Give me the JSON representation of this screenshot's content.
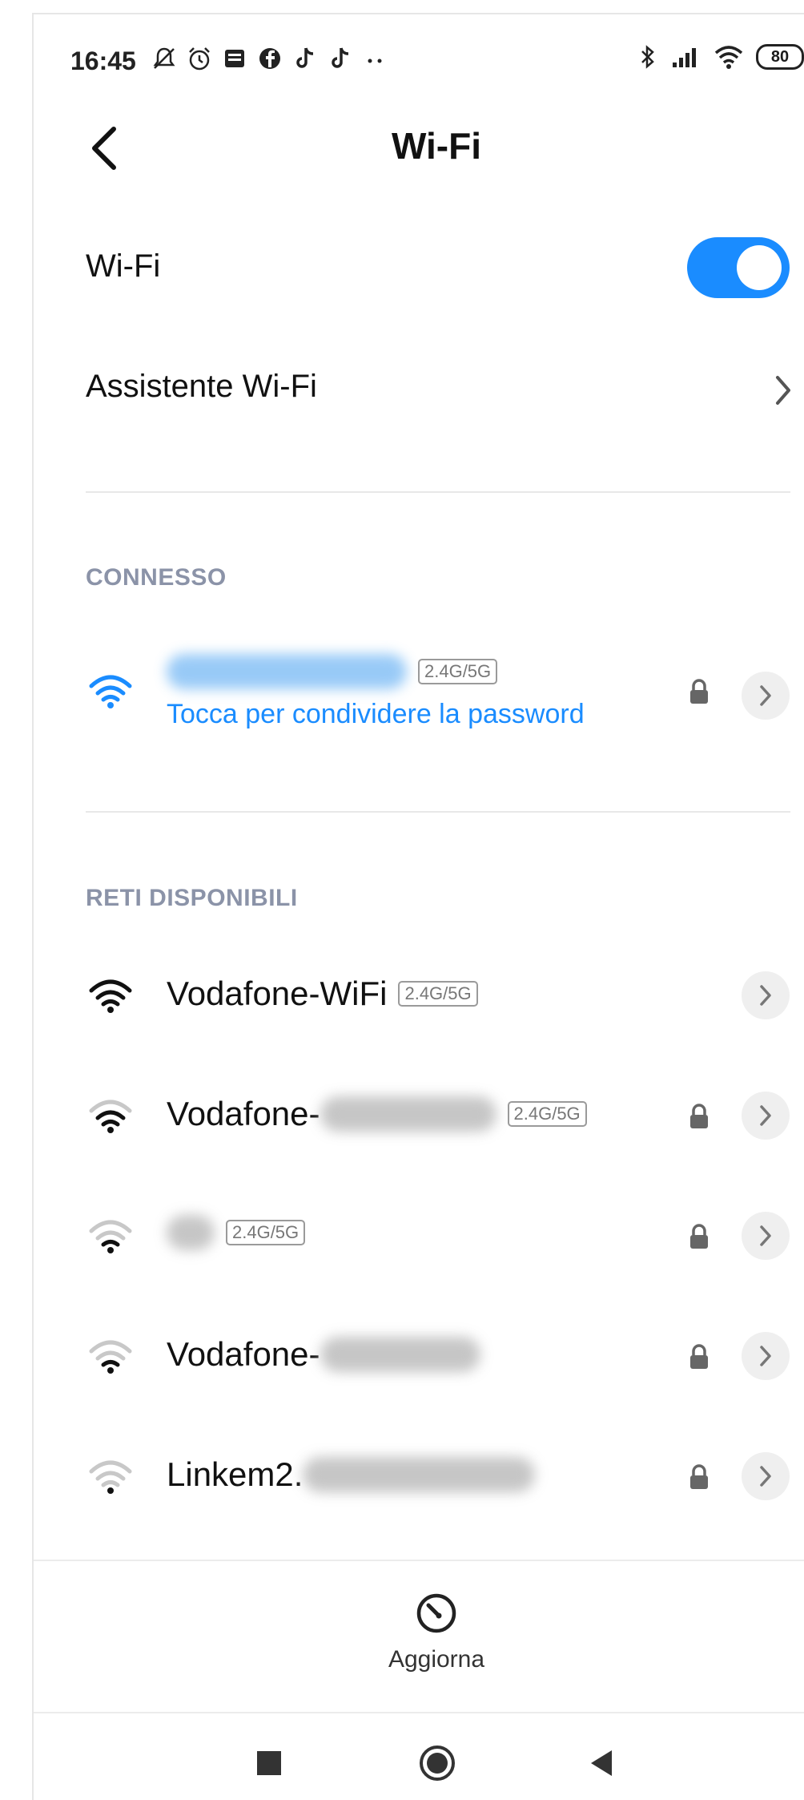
{
  "status_bar": {
    "time": "16:45",
    "left_icons": [
      "mute-bell-icon",
      "alarm-icon",
      "message-icon",
      "facebook-icon",
      "tiktok-icon",
      "tiktok-icon",
      "more-dots-icon"
    ],
    "right_icons": [
      "bluetooth-icon",
      "signal-icon",
      "wifi-icon"
    ],
    "battery": "80"
  },
  "header": {
    "title": "Wi-Fi"
  },
  "settings": {
    "wifi_label": "Wi-Fi",
    "wifi_enabled": true,
    "assistant_label": "Assistente Wi-Fi"
  },
  "connected": {
    "section_label": "CONNESSO",
    "band": "2.4G/5G",
    "subtitle": "Tocca per condividere la password",
    "secured": true
  },
  "available": {
    "section_label": "RETI DISPONIBILI",
    "networks": [
      {
        "name": "Vodafone-WiFi",
        "band": "2.4G/5G",
        "secured": false,
        "signal": 4
      },
      {
        "name": "Vodafone-",
        "band": "2.4G/5G",
        "secured": true,
        "signal": 3
      },
      {
        "name": "",
        "band": "2.4G/5G",
        "secured": true,
        "signal": 2
      },
      {
        "name": "Vodafone-",
        "band": "",
        "secured": true,
        "signal": 2
      },
      {
        "name": "Linkem2.",
        "band": "",
        "secured": true,
        "signal": 1
      }
    ]
  },
  "footer": {
    "refresh_label": "Aggiorna"
  },
  "colors": {
    "accent": "#1a8cff",
    "section_label": "#8b93a8"
  }
}
